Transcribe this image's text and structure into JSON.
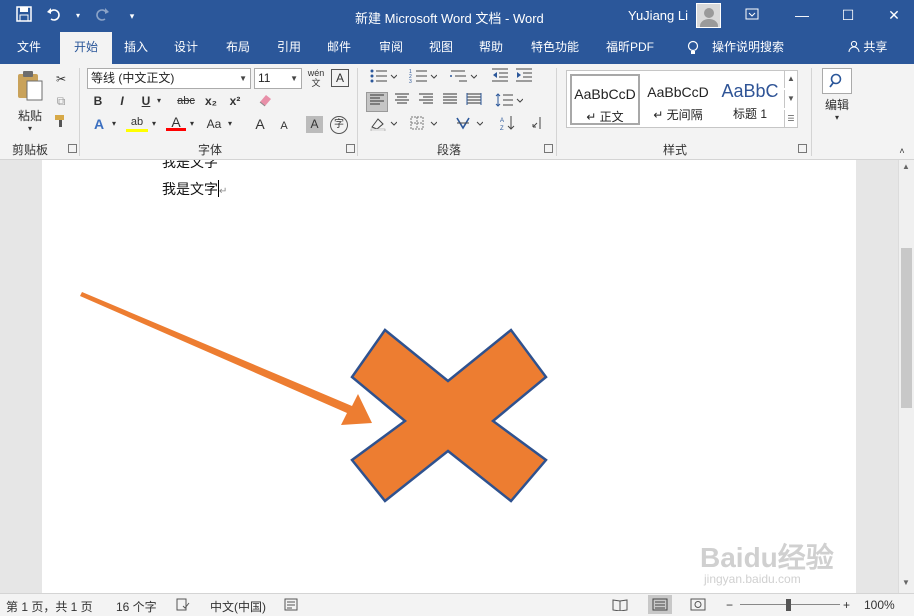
{
  "titlebar": {
    "title": "新建 Microsoft Word 文档  -  Word",
    "user": "YuJiang Li",
    "qat": {
      "save_icon": "save-icon",
      "undo_icon": "undo-icon",
      "redo_icon": "redo-icon",
      "customize_icon": "customize-icon"
    },
    "window_buttons": [
      "ribbon-display-icon",
      "minimize-icon",
      "maximize-icon",
      "close-icon"
    ]
  },
  "tabs": [
    {
      "label": "文件"
    },
    {
      "label": "开始"
    },
    {
      "label": "插入"
    },
    {
      "label": "设计"
    },
    {
      "label": "布局"
    },
    {
      "label": "引用"
    },
    {
      "label": "邮件"
    },
    {
      "label": "审阅"
    },
    {
      "label": "视图"
    },
    {
      "label": "帮助"
    },
    {
      "label": "特色功能"
    },
    {
      "label": "福昕PDF"
    },
    {
      "label": "操作说明搜索"
    }
  ],
  "share_label": "共享",
  "ribbon": {
    "clipboard": {
      "label": "剪贴板",
      "paste": "粘贴"
    },
    "font": {
      "label": "字体",
      "font_name": "等线 (中文正文)",
      "font_size": "11",
      "bold": "B",
      "italic": "I",
      "underline": "U",
      "strike": "abc",
      "subscript": "x₂",
      "superscript": "x²",
      "phonetic": "wén",
      "case": "Aa",
      "grow": "A",
      "shrink": "A",
      "char_border": "A",
      "enclose": "字",
      "highlight_color": "#ffff00",
      "font_color": "#ff0000"
    },
    "paragraph": {
      "label": "段落"
    },
    "styles": {
      "label": "样式",
      "items": [
        {
          "sample": "AaBbCcD",
          "name": "↵ 正文"
        },
        {
          "sample": "AaBbCcD",
          "name": "↵ 无间隔"
        },
        {
          "sample": "AaBbC",
          "name": "标题 1"
        }
      ]
    },
    "editing": {
      "label": "编辑"
    }
  },
  "document": {
    "line1": "我是文字",
    "line2": "我是文字"
  },
  "shapes": {
    "arrow_color": "#ed7d31",
    "x_fill": "#ed7d31",
    "x_stroke": "#2f528f"
  },
  "statusbar": {
    "page": "第 1 页，共 1 页",
    "words": "16 个字",
    "language": "中文(中国)",
    "zoom": "100%"
  },
  "watermark": {
    "text": "Baidu经验",
    "sub": "jingyan.baidu.com"
  }
}
